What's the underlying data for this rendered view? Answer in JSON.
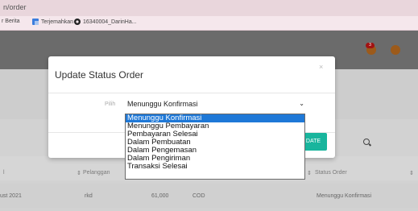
{
  "browser": {
    "url": "n/order",
    "bookmarks": [
      {
        "label": "r Berita",
        "icon": "news-icon"
      },
      {
        "label": "Terjemahkan",
        "icon": "translate-icon"
      },
      {
        "label": "16340004_DarinHa...",
        "icon": "github-icon"
      }
    ]
  },
  "topnav": {
    "notification_count": "3",
    "message_count": ""
  },
  "table": {
    "headers": [
      "l",
      "Pelanggan",
      "Status Order"
    ],
    "row": [
      "ust 2021",
      "rkd",
      "61,000",
      "COD",
      "Menunggu Konfirmasi"
    ]
  },
  "modal": {
    "title": "Update Status Order",
    "close": "×",
    "field_label": "Pilih",
    "selected_value": "Menunggu Konfirmasi",
    "submit_label": "DATE"
  },
  "dropdown": {
    "options": [
      "Menunggu Konfirmasi",
      "Menunggu Pembayaran",
      "Pembayaran Selesai",
      "Dalam Pembuatan",
      "Dalam Pengemasan",
      "Dalam Pengiriman",
      "Transaksi Selesai"
    ],
    "selected_index": 0
  },
  "colors": {
    "accent": "#18b59d",
    "highlight": "#1e78d7",
    "overlay": "#6b6b6b"
  }
}
